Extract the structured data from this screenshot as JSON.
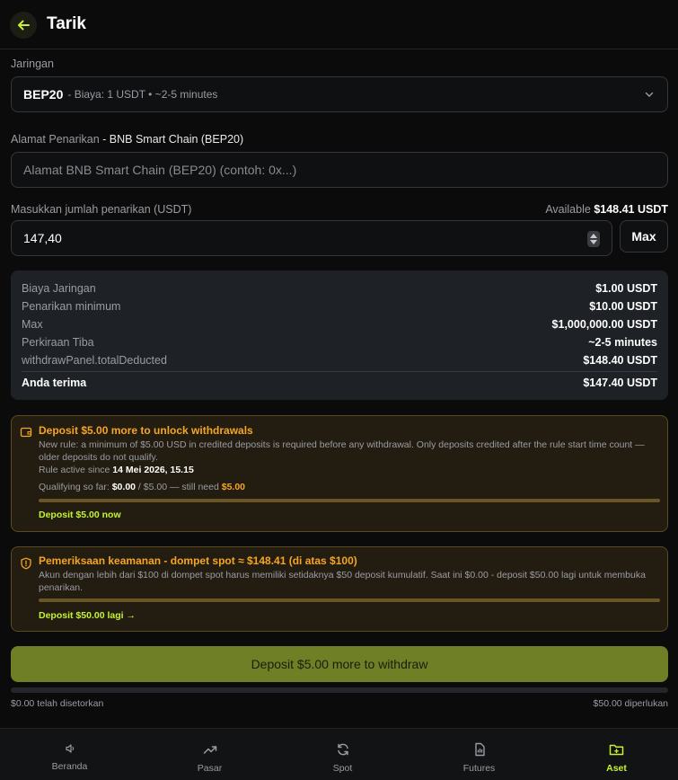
{
  "header": {
    "title": "Tarik",
    "back_icon": "arrow-left-icon"
  },
  "network": {
    "label": "Jaringan",
    "selected_name": "BEP20",
    "selected_meta": "- Biaya: 1 USDT • ~2-5 minutes"
  },
  "address": {
    "label": "Alamat Penarikan",
    "label_strong": " - BNB Smart Chain (BEP20)",
    "placeholder": "Alamat BNB Smart Chain (BEP20) (contoh: 0x...)"
  },
  "amount": {
    "label": "Masukkan jumlah penarikan (USDT)",
    "available_label": "Available",
    "available_value": "$148.41 USDT",
    "value": "147,40",
    "max_label": "Max"
  },
  "summary": {
    "rows": [
      {
        "k": "Biaya Jaringan",
        "v": "$1.00 USDT"
      },
      {
        "k": "Penarikan minimum",
        "v": "$10.00 USDT"
      },
      {
        "k": "Max",
        "v": "$1,000,000.00 USDT"
      },
      {
        "k": "Perkiraan Tiba",
        "v": "~2-5 minutes"
      },
      {
        "k": "withdrawPanel.totalDeducted",
        "v": "$148.40 USDT"
      }
    ],
    "total": {
      "k": "Anda terima",
      "v": "$147.40 USDT"
    }
  },
  "deposit_rule": {
    "title": "Deposit $5.00 more to unlock withdrawals",
    "text": "New rule: a minimum of $5.00 USD in credited deposits is required before any withdrawal. Only deposits credited after the rule start time count — older deposits do not qualify.",
    "since_label": "Rule active since",
    "since_value": "14 Mei 2026, 15.15",
    "qualify_label": "Qualifying so far:",
    "qualify_current": "$0.00",
    "qualify_target": "/ $5.00 — still need",
    "qualify_need": "$5.00",
    "progress_fraction": 0,
    "link": "Deposit $5.00 now"
  },
  "security": {
    "title": "Pemeriksaan keamanan - dompet spot ≈ $148.41 (di atas $100)",
    "text": "Akun dengan lebih dari $100 di dompet spot harus memiliki setidaknya $50 deposit kumulatif. Saat ini $0.00 - deposit $50.00 lagi untuk membuka penarikan.",
    "progress_fraction": 0,
    "link": "Deposit $50.00 lagi →"
  },
  "cta": {
    "label": "Deposit $5.00 more to withdraw"
  },
  "deposit_progress": {
    "left": "$0.00 telah disetorkan",
    "right": "$50.00 diperlukan",
    "fraction": 0
  },
  "nav": {
    "items": [
      {
        "label": "Beranda",
        "icon": "home-icon",
        "active": false
      },
      {
        "label": "Pasar",
        "icon": "trend-up-icon",
        "active": false
      },
      {
        "label": "Spot",
        "icon": "swap-icon",
        "active": false
      },
      {
        "label": "Futures",
        "icon": "document-chart-icon",
        "active": false
      },
      {
        "label": "Aset",
        "icon": "wallet-folder-icon",
        "active": true
      }
    ]
  },
  "colors": {
    "accent": "#c6f135",
    "warning": "#f5a524",
    "cta_bg": "#6f7f26"
  }
}
